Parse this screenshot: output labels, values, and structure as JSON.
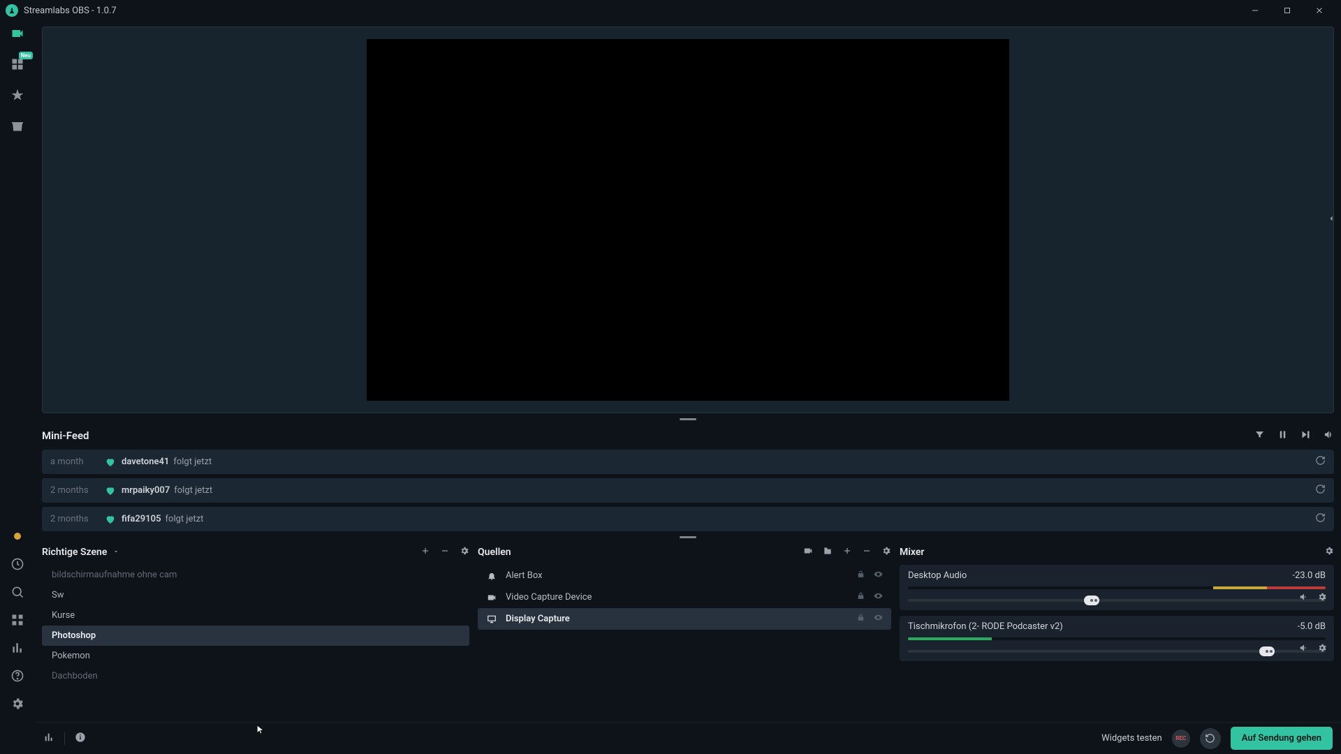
{
  "app": {
    "title": "Streamlabs OBS - 1.0.7",
    "badge_new": "Neu"
  },
  "minifeed": {
    "title": "Mini-Feed",
    "items": [
      {
        "time": "a month",
        "user": "davetone41",
        "action": "folgt jetzt"
      },
      {
        "time": "2 months",
        "user": "mrpaiky007",
        "action": "folgt jetzt"
      },
      {
        "time": "2 months",
        "user": "fifa29105",
        "action": "folgt jetzt"
      }
    ]
  },
  "scenes": {
    "title": "Richtige Szene",
    "items": [
      {
        "label": "bildschirmaufnahme ohne cam",
        "dim": true
      },
      {
        "label": "Sw"
      },
      {
        "label": "Kurse"
      },
      {
        "label": "Photoshop",
        "selected": true
      },
      {
        "label": "Pokemon"
      },
      {
        "label": "Dachboden",
        "dim": true
      }
    ]
  },
  "sources": {
    "title": "Quellen",
    "items": [
      {
        "icon": "bell",
        "label": "Alert Box"
      },
      {
        "icon": "camera",
        "label": "Video Capture Device"
      },
      {
        "icon": "monitor",
        "label": "Display Capture",
        "selected": true
      }
    ]
  },
  "mixer": {
    "title": "Mixer",
    "channels": [
      {
        "name": "Desktop Audio",
        "db": "-23.0 dB",
        "meter_g": 0,
        "meter_y_from": 73,
        "meter_y_to": 86,
        "meter_r_from": 86,
        "meter_r_to": 100,
        "thumb_pct": 44
      },
      {
        "name": "Tischmikrofon (2- RODE Podcaster v2)",
        "db": "-5.0 dB",
        "meter_g": 20,
        "meter_y_from": 36,
        "meter_y_to": 36,
        "meter_r_from": 0,
        "meter_r_to": 0,
        "thumb_pct": 86
      }
    ]
  },
  "footer": {
    "widgets_test": "Widgets testen",
    "rec_label": "REC",
    "go_live": "Auf Sendung gehen"
  }
}
